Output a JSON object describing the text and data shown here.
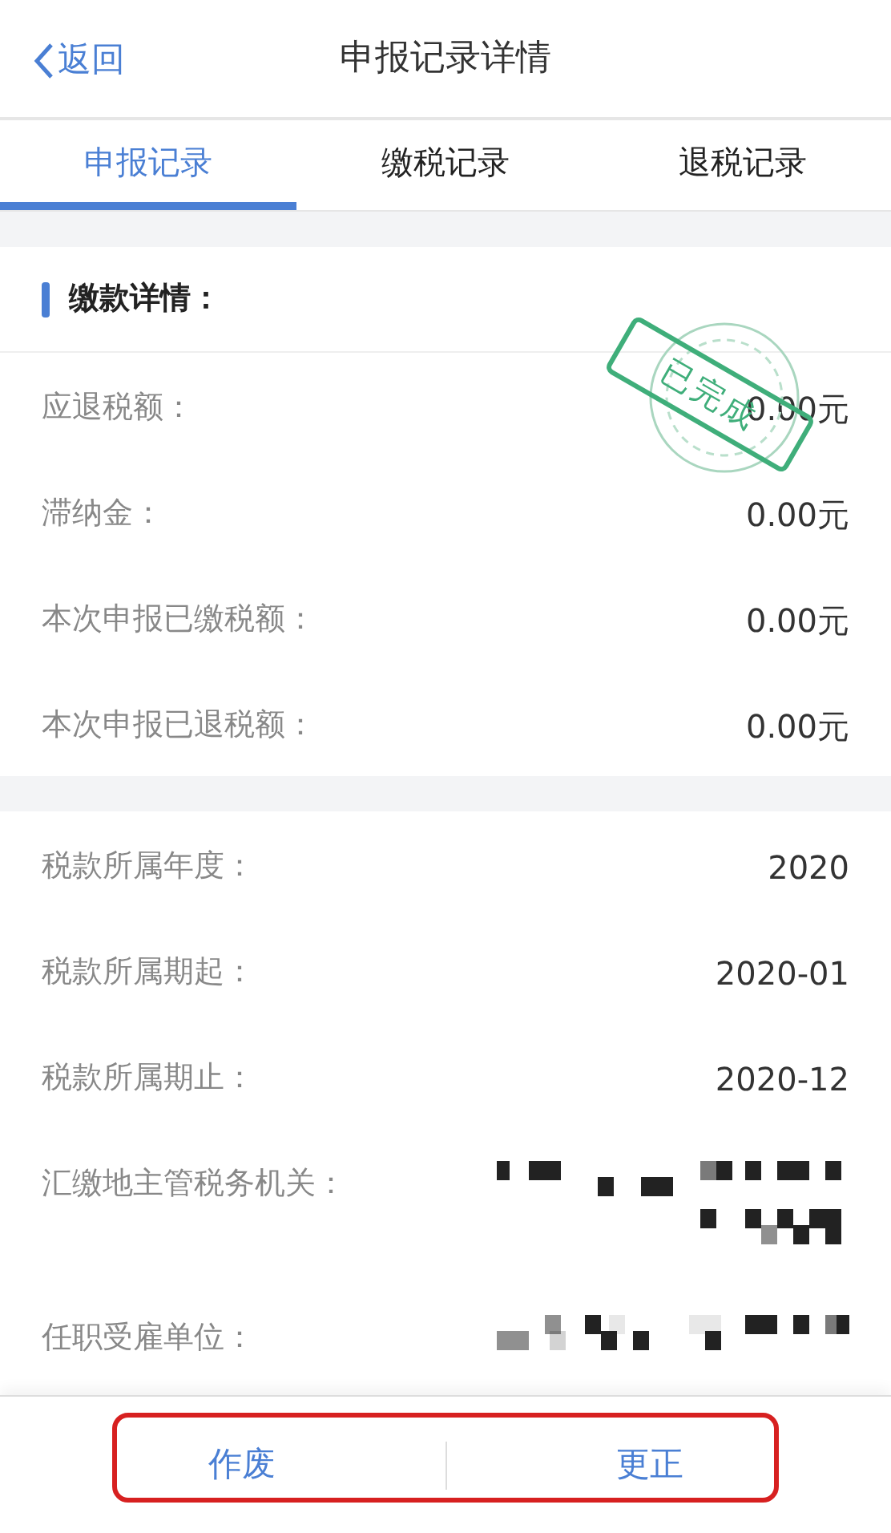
{
  "header": {
    "back": "返回",
    "title": "申报记录详情"
  },
  "tabs": [
    {
      "label": "申报记录",
      "selected": true
    },
    {
      "label": "缴税记录",
      "selected": false
    },
    {
      "label": "退税记录",
      "selected": false
    }
  ],
  "sections": [
    {
      "title": "缴款详情：",
      "stamp": "已完成",
      "rows": [
        {
          "label": "应退税额：",
          "kind": "text",
          "value": "0.00元"
        },
        {
          "label": "滞纳金：",
          "kind": "text",
          "value": "0.00元"
        },
        {
          "label": "本次申报已缴税额：",
          "kind": "text",
          "value": "0.00元"
        },
        {
          "label": "本次申报已退税额：",
          "kind": "text",
          "value": "0.00元"
        }
      ]
    },
    {
      "rows": [
        {
          "label": "税款所属年度：",
          "kind": "text",
          "value": "2020"
        },
        {
          "label": "税款所属期起：",
          "kind": "text",
          "value": "2020-01"
        },
        {
          "label": "税款所属期止：",
          "kind": "text",
          "value": "2020-12"
        },
        {
          "label": "汇缴地主管税务机关：",
          "kind": "redacted"
        },
        {
          "label": "任职受雇单位：",
          "kind": "redacted"
        }
      ]
    }
  ],
  "footer": {
    "buttons": [
      "作废",
      "更正"
    ],
    "highlighted": true
  }
}
